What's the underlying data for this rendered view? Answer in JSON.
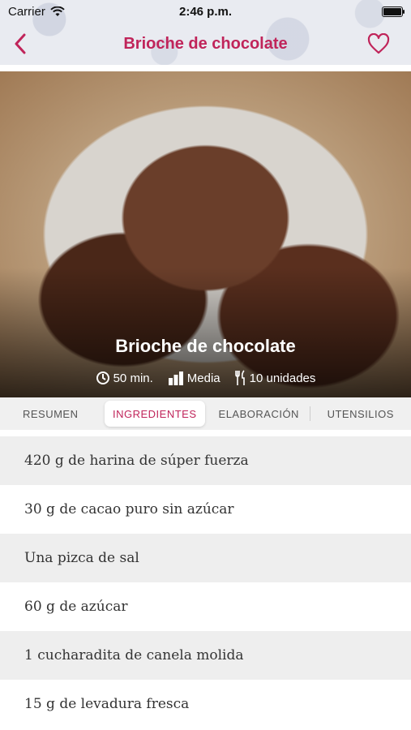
{
  "status": {
    "carrier": "Carrier",
    "time": "2:46 p.m."
  },
  "nav": {
    "title": "Brioche de chocolate"
  },
  "hero": {
    "title": "Brioche de chocolate",
    "time": "50 min.",
    "difficulty": "Media",
    "servings": "10 unidades"
  },
  "tabs": [
    "RESUMEN",
    "INGREDIENTES",
    "ELABORACIÓN",
    "UTENSILIOS"
  ],
  "ingredients": [
    "420 g de harina de súper fuerza",
    "30 g de cacao puro sin azúcar",
    "Una pizca de sal",
    "60 g de azúcar",
    "1 cucharadita de canela molida",
    "15 g de levadura fresca"
  ],
  "colors": {
    "accent": "#c0245a"
  }
}
